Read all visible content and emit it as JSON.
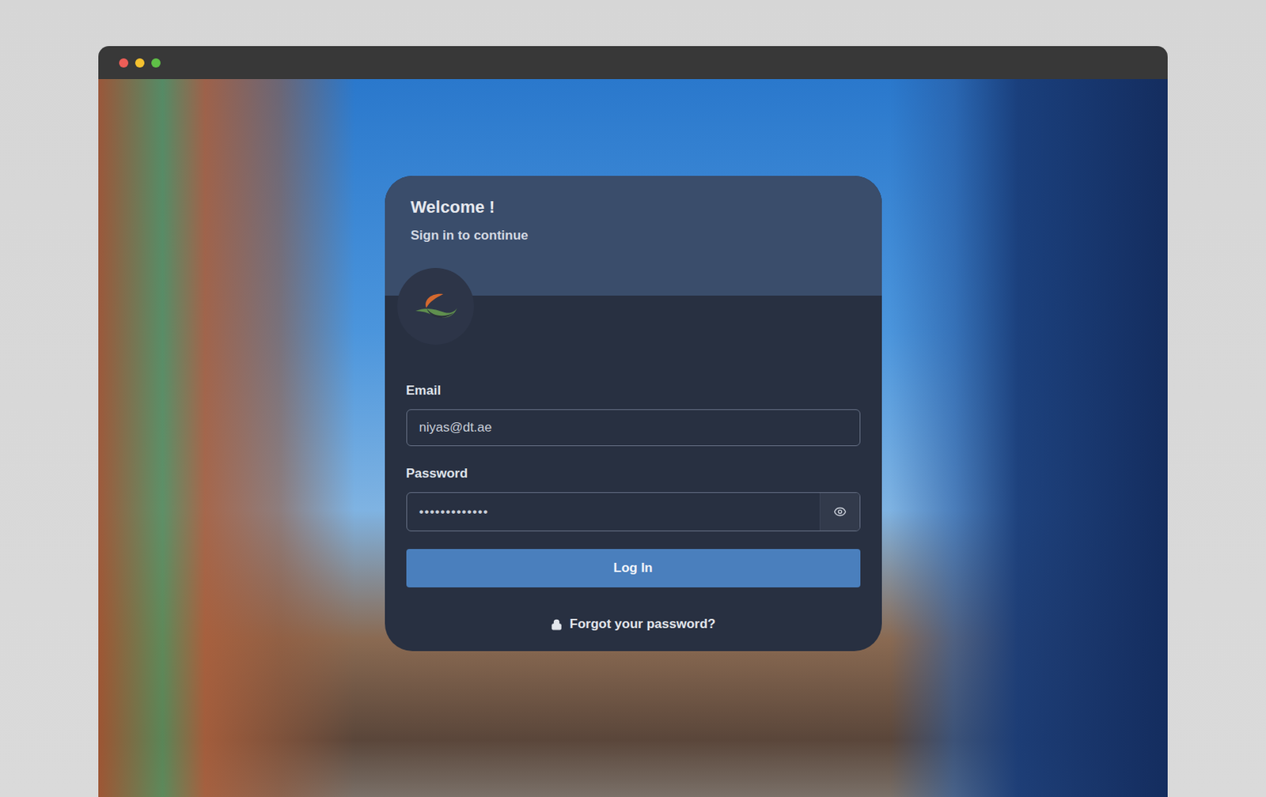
{
  "login": {
    "title": "Welcome !",
    "subtitle": "Sign in to continue",
    "fields": [
      {
        "label": "Email",
        "value": "niyas@dt.ae",
        "kind": "text"
      },
      {
        "label": "Password",
        "value": "•••••••••••••",
        "kind": "password"
      }
    ],
    "submit": "Log In",
    "forgot": "Forgot your password?"
  }
}
